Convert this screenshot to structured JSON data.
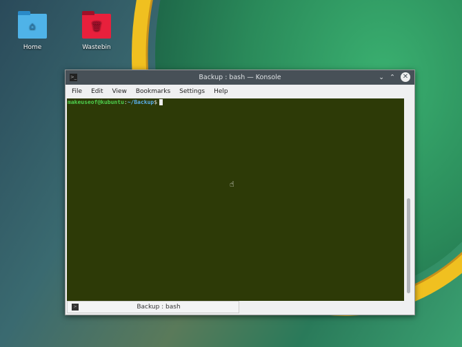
{
  "desktop": {
    "icons": [
      {
        "label": "Home",
        "color": "#4fb3e8"
      },
      {
        "label": "Wastebin",
        "color": "#e8203c"
      }
    ]
  },
  "window": {
    "title": "Backup : bash — Konsole",
    "menu": [
      "File",
      "Edit",
      "View",
      "Bookmarks",
      "Settings",
      "Help"
    ],
    "terminal": {
      "user_host": "makeuseof@kubuntu",
      "sep": ":",
      "path": "~/Backup",
      "prompt": "$"
    },
    "tab_label": "Backup : bash"
  }
}
